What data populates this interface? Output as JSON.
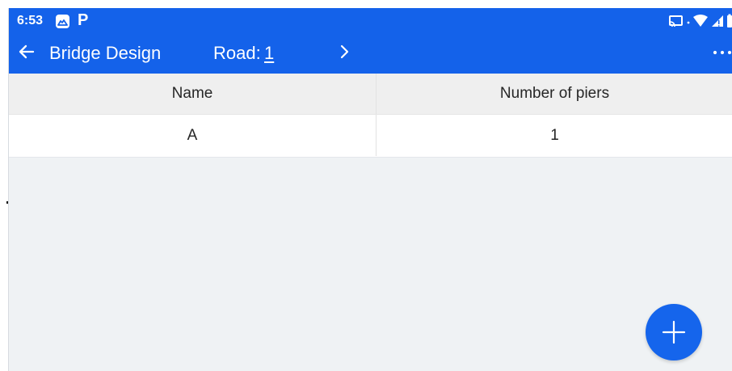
{
  "status_bar": {
    "time": "6:53",
    "icons": [
      "app-mountain-icon",
      "p-icon",
      "cast-icon",
      "dot-icon",
      "wifi-icon",
      "signal-icon",
      "battery-icon"
    ],
    "p_symbol": "P"
  },
  "toolbar": {
    "title": "Bridge Design",
    "road_label": "Road:",
    "road_value": "1",
    "back_icon": "arrow-left-icon",
    "next_icon": "chevron-right-icon",
    "more_icon": "more-horizontal-icon"
  },
  "table": {
    "columns": [
      "Name",
      "Number of piers"
    ],
    "rows": [
      {
        "name": "A",
        "number_of_piers": "1"
      }
    ]
  },
  "actions": {
    "add_icon": "plus-icon"
  },
  "colors": {
    "app_bar": "#1462ea",
    "background": "#eff2f4",
    "table_header": "#efefef",
    "fab": "#1565ec",
    "text": "#262626"
  }
}
